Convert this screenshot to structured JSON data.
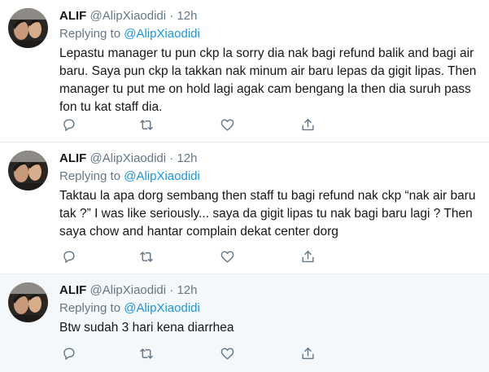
{
  "tweets": [
    {
      "name": "ALIF",
      "handle": "@AlipXiaodidi",
      "dot": "·",
      "time": "12h",
      "replying_prefix": "Replying to ",
      "replying_to": "@AlipXiaodidi",
      "text": "Lepastu manager tu pun ckp la sorry dia nak bagi refund balik and bagi air baru. Saya pun ckp la takkan nak minum air baru lepas da gigit lipas. Then manager tu put me on hold lagi agak cam bengang la then dia suruh pass fon tu kat staff dia."
    },
    {
      "name": "ALIF",
      "handle": "@AlipXiaodidi",
      "dot": "·",
      "time": "12h",
      "replying_prefix": "Replying to ",
      "replying_to": "@AlipXiaodidi",
      "text": "Taktau la apa dorg sembang then staff tu bagi refund nak ckp “nak air baru tak ?” I was like seriously... saya da gigit lipas tu nak bagi baru lagi ? Then saya chow and hantar complain dekat center dorg"
    },
    {
      "name": "ALIF",
      "handle": "@AlipXiaodidi",
      "dot": "·",
      "time": "12h",
      "replying_prefix": "Replying to ",
      "replying_to": "@AlipXiaodidi",
      "text": "Btw sudah 3 hari kena diarrhea"
    }
  ],
  "icons": {
    "reply": "reply-icon",
    "retweet": "retweet-icon",
    "like": "heart-icon",
    "share": "share-icon"
  },
  "colors": {
    "accent": "#1b95e0",
    "secondary_text": "#657786",
    "highlight_bg": "#f5f8fa"
  }
}
